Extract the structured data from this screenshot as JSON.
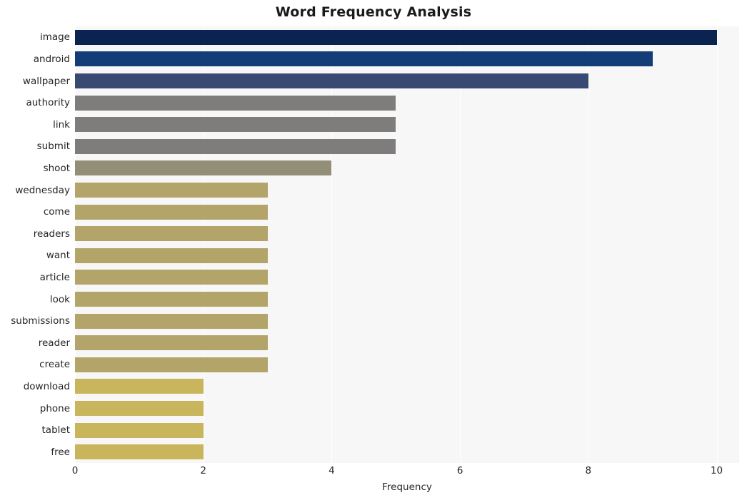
{
  "chart_data": {
    "type": "bar",
    "orientation": "horizontal",
    "title": "Word Frequency Analysis",
    "xlabel": "Frequency",
    "ylabel": "",
    "xlim": [
      0,
      10.35
    ],
    "xticks": [
      0,
      2,
      4,
      6,
      8,
      10
    ],
    "xtick_labels": [
      "0",
      "2",
      "4",
      "6",
      "8",
      "10"
    ],
    "grid": "vertical",
    "legend": null,
    "categories": [
      "image",
      "android",
      "wallpaper",
      "authority",
      "link",
      "submit",
      "shoot",
      "wednesday",
      "come",
      "readers",
      "want",
      "article",
      "look",
      "submissions",
      "reader",
      "create",
      "download",
      "phone",
      "tablet",
      "free"
    ],
    "values": [
      10,
      9,
      8,
      5,
      5,
      5,
      4,
      3,
      3,
      3,
      3,
      3,
      3,
      3,
      3,
      3,
      2,
      2,
      2,
      2
    ],
    "bar_colors": [
      "#0b2350",
      "#123d76",
      "#394a72",
      "#7e7d7c",
      "#7e7d7c",
      "#7e7d7c",
      "#938e78",
      "#b3a469",
      "#b3a469",
      "#b3a469",
      "#b3a469",
      "#b3a469",
      "#b3a469",
      "#b3a469",
      "#b3a469",
      "#b3a469",
      "#c8b55c",
      "#c8b55c",
      "#c8b55c",
      "#c8b55c"
    ],
    "plot_background": "#f7f7f7",
    "grid_color": "#ffffff"
  }
}
